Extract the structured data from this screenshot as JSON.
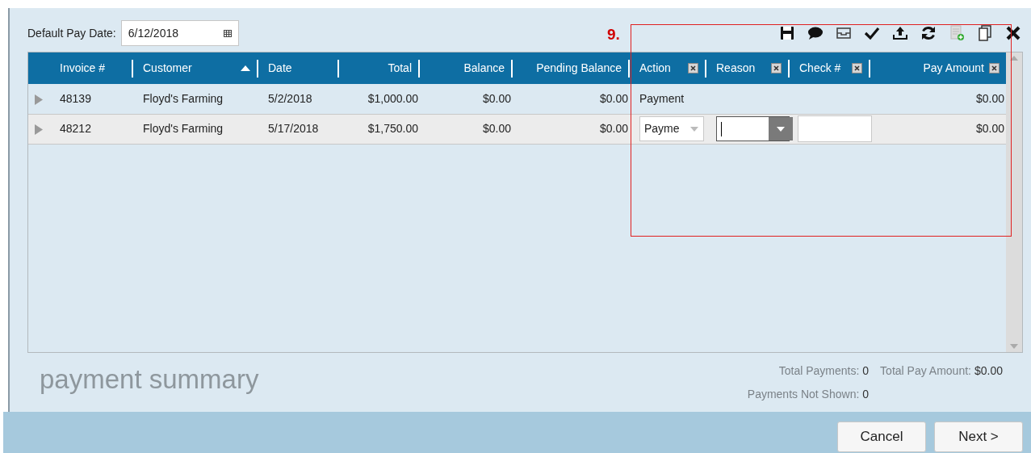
{
  "pay_date": {
    "label": "Default Pay Date:",
    "value": "6/12/2018"
  },
  "annotation": {
    "label": "9."
  },
  "toolbar": [
    {
      "kind": "save"
    },
    {
      "kind": "comment"
    },
    {
      "kind": "tray"
    },
    {
      "kind": "check"
    },
    {
      "kind": "upload"
    },
    {
      "kind": "refresh"
    },
    {
      "kind": "add-document"
    },
    {
      "kind": "copy"
    },
    {
      "kind": "close"
    }
  ],
  "table": {
    "columns": [
      {
        "label": "Invoice #",
        "sorted": false,
        "removable": false
      },
      {
        "label": "Customer",
        "sorted": true,
        "removable": false
      },
      {
        "label": "Date",
        "sorted": false,
        "removable": false
      },
      {
        "label": "Total",
        "sorted": false,
        "removable": false
      },
      {
        "label": "Balance",
        "sorted": false,
        "removable": false
      },
      {
        "label": "Pending Balance",
        "sorted": false,
        "removable": false
      },
      {
        "label": "Action",
        "sorted": false,
        "removable": true
      },
      {
        "label": "Reason",
        "sorted": false,
        "removable": true
      },
      {
        "label": "Check #",
        "sorted": false,
        "removable": true
      },
      {
        "label": "Pay Amount",
        "sorted": false,
        "removable": true
      }
    ],
    "rows": [
      {
        "editing": false,
        "cells": [
          {
            "kind": "text",
            "text": "48139"
          },
          {
            "kind": "text",
            "text": "Floyd's Farming"
          },
          {
            "kind": "text",
            "text": "5/2/2018"
          },
          {
            "kind": "text",
            "text": "$1,000.00"
          },
          {
            "kind": "text",
            "text": "$0.00"
          },
          {
            "kind": "text",
            "text": "$0.00"
          },
          {
            "kind": "text",
            "text": "Payment"
          },
          {
            "kind": "empty"
          },
          {
            "kind": "empty"
          },
          {
            "kind": "text",
            "text": "$0.00"
          }
        ]
      },
      {
        "editing": true,
        "cells": [
          {
            "kind": "text",
            "text": "48212"
          },
          {
            "kind": "text",
            "text": "Floyd's Farming"
          },
          {
            "kind": "text",
            "text": "5/17/2018"
          },
          {
            "kind": "text",
            "text": "$1,750.00"
          },
          {
            "kind": "text",
            "text": "$0.00"
          },
          {
            "kind": "text",
            "text": "$0.00"
          },
          {
            "kind": "select",
            "text": "Payme"
          },
          {
            "kind": "combo",
            "text": ""
          },
          {
            "kind": "input",
            "text": ""
          },
          {
            "kind": "text",
            "text": "$0.00"
          }
        ]
      }
    ]
  },
  "summary": {
    "title": "payment summary",
    "stats": [
      {
        "label": "Total Payments:",
        "value": "0"
      },
      {
        "label": "Total Pay Amount:",
        "value": "$0.00"
      },
      {
        "label": "Payments Not Shown:",
        "value": "0"
      }
    ]
  },
  "buttons": [
    {
      "label": "Cancel"
    },
    {
      "label": "Next >"
    }
  ]
}
